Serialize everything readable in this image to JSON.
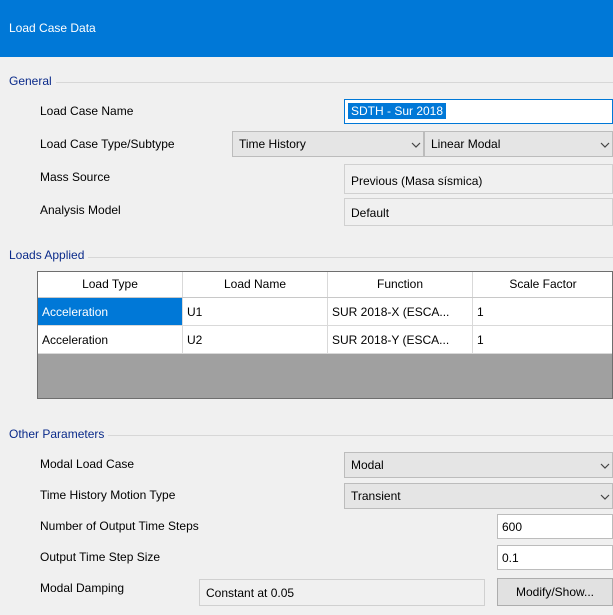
{
  "window": {
    "title": "Load Case Data"
  },
  "general": {
    "section_label": "General",
    "load_case_name_label": "Load Case Name",
    "load_case_name_value": "SDTH - Sur 2018",
    "type_subtype_label": "Load Case Type/Subtype",
    "type_value": "Time History",
    "subtype_value": "Linear Modal",
    "mass_source_label": "Mass Source",
    "mass_source_value": "Previous  (Masa sísmica)",
    "analysis_model_label": "Analysis Model",
    "analysis_model_value": "Default"
  },
  "loads_applied": {
    "section_label": "Loads Applied",
    "columns": [
      "Load Type",
      "Load Name",
      "Function",
      "Scale Factor"
    ],
    "rows": [
      [
        "Acceleration",
        "U1",
        "SUR 2018-X (ESCA...",
        "1"
      ],
      [
        "Acceleration",
        "U2",
        "SUR 2018-Y (ESCA...",
        "1"
      ]
    ]
  },
  "other_parameters": {
    "section_label": "Other Parameters",
    "modal_load_case_label": "Modal Load Case",
    "modal_load_case_value": "Modal",
    "motion_type_label": "Time History Motion Type",
    "motion_type_value": "Transient",
    "num_steps_label": "Number of Output Time Steps",
    "num_steps_value": "600",
    "step_size_label": "Output Time Step Size",
    "step_size_value": "0.1",
    "modal_damping_label": "Modal Damping",
    "modal_damping_value": "Constant at 0.05",
    "modify_show_button": "Modify/Show..."
  },
  "colors": {
    "titlebar": "#0078d7",
    "selection": "#0078d7",
    "section_label": "#0a2a8a"
  },
  "icons": {
    "dropdown": "chevron-down-icon"
  }
}
